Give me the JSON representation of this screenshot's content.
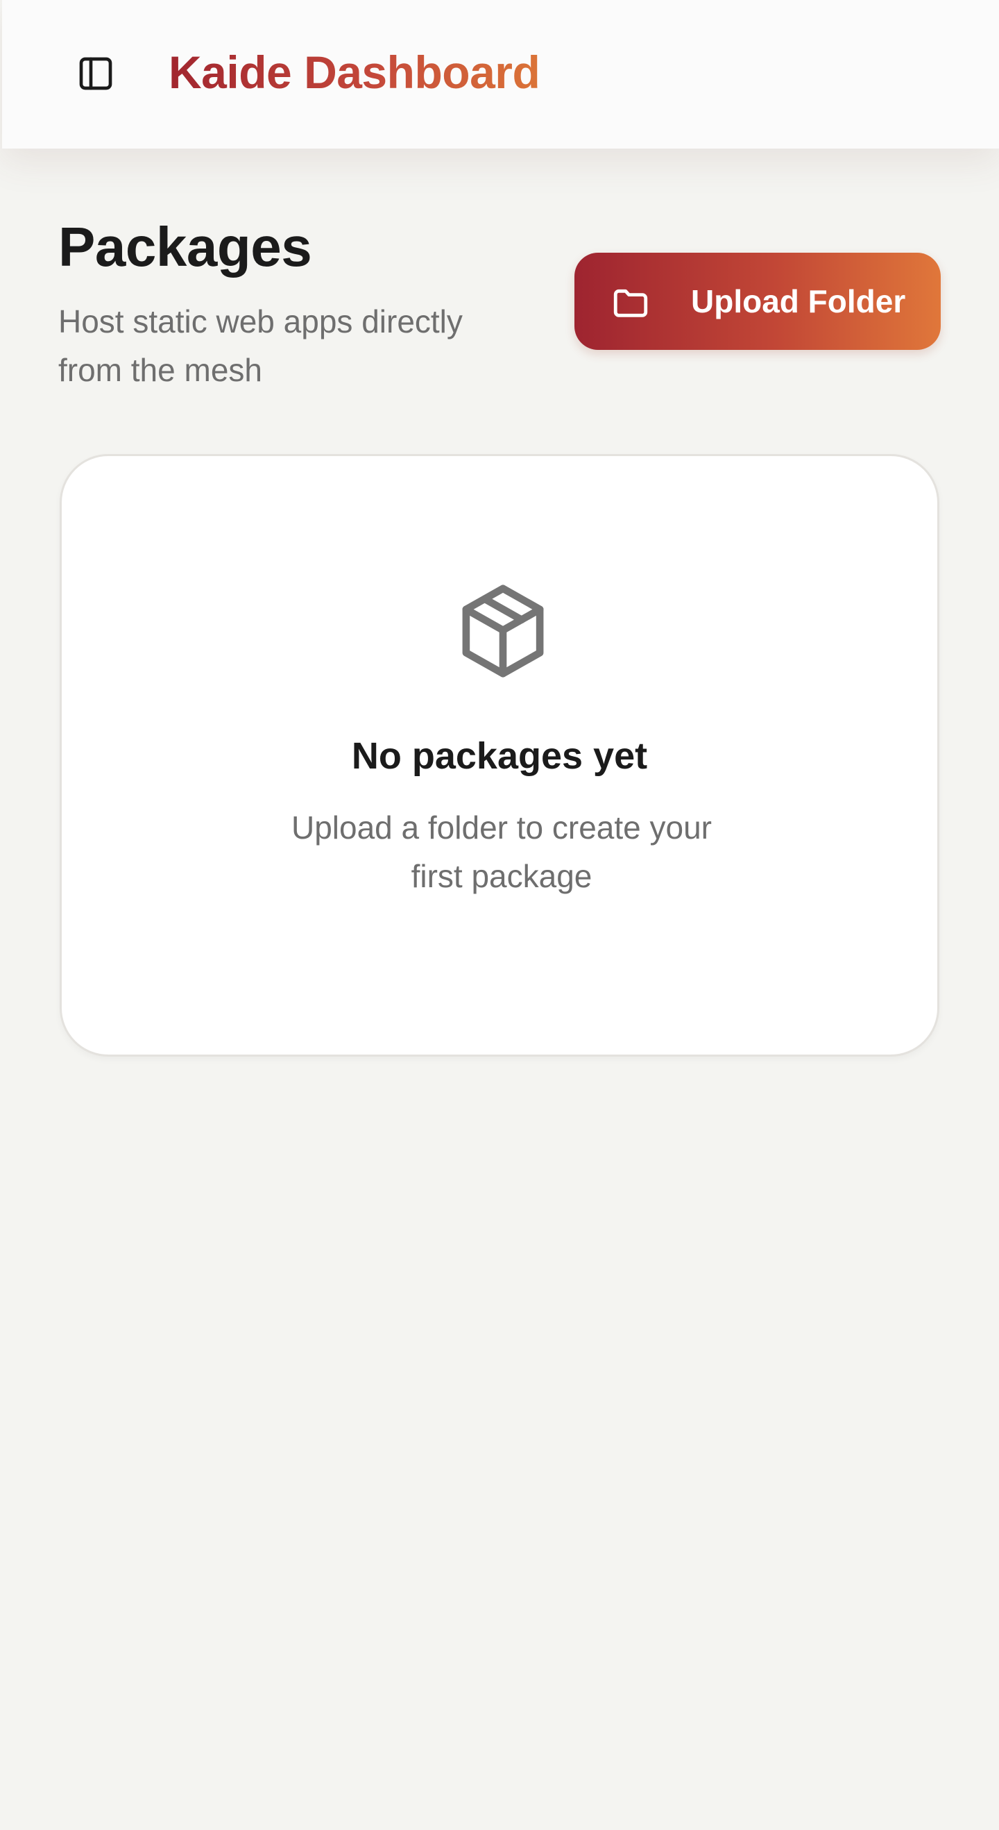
{
  "header": {
    "brand": "Kaide Dashboard",
    "toggle_icon": "sidebar-toggle-icon"
  },
  "page": {
    "title": "Packages",
    "subtitle": "Host static web apps directly from the mesh",
    "upload_button_label": "Upload Folder",
    "upload_button_icon": "folder-icon"
  },
  "empty_state": {
    "icon": "package-icon",
    "title": "No packages yet",
    "text": "Upload a folder to create your first package"
  },
  "colors": {
    "background": "#f4f4f1",
    "accent_start": "#a1262f",
    "accent_end": "#e0773a",
    "text_primary": "#1b1b1b",
    "text_muted": "#6e6e6e"
  }
}
